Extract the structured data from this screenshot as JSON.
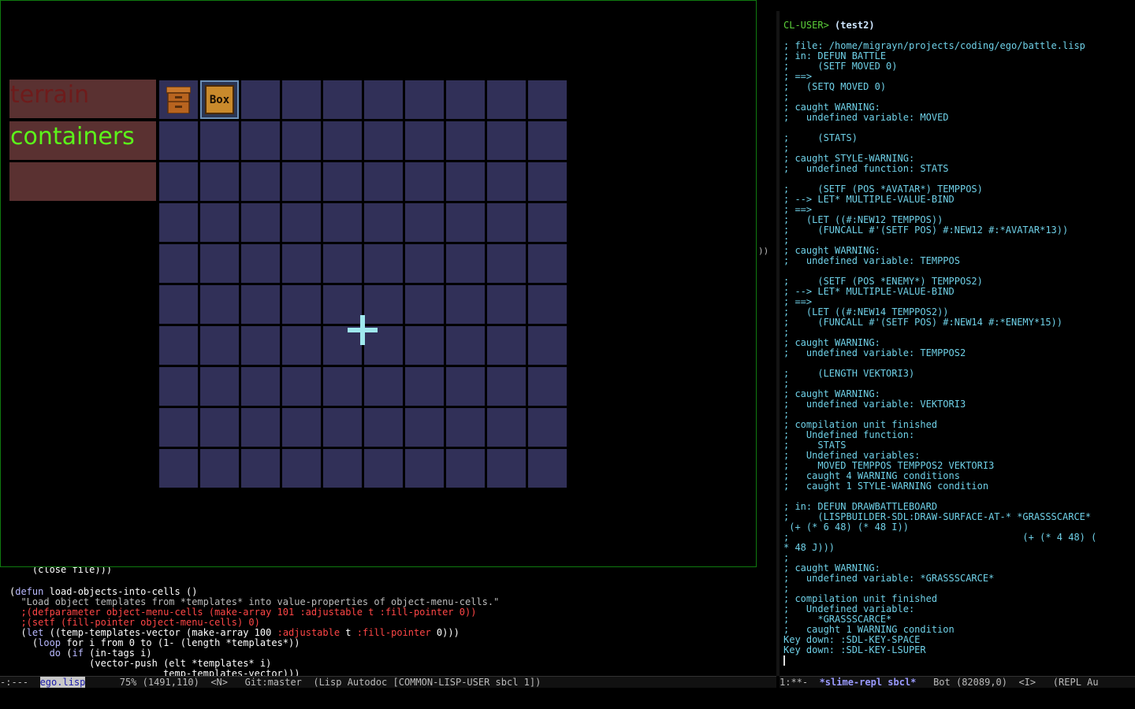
{
  "game": {
    "menu": [
      {
        "label": "terrain",
        "color": "#6e1b1b"
      },
      {
        "label": "containers",
        "color": "#5cf51a"
      },
      {
        "label": "",
        "color": "#5a3131"
      }
    ],
    "grid": {
      "cols": 10,
      "rows": 10,
      "cell_color": "#313058",
      "selected_cell": [
        1,
        0
      ]
    },
    "icons": [
      {
        "name": "cabinet-icon"
      },
      {
        "name": "box-icon",
        "text": "Box"
      }
    ]
  },
  "editor": {
    "lines": [
      {
        "segments": [
          {
            "t": "    (close file)))",
            "c": "plain"
          }
        ]
      },
      {
        "segments": [
          {
            "t": "(",
            "c": "plain"
          },
          {
            "t": "defun",
            "c": "kw"
          },
          {
            "t": " load-objects-into-cells ()",
            "c": "plain"
          }
        ]
      },
      {
        "segments": [
          {
            "t": "  \"Load object templates from *templates* into value-properties of object-menu-cells.\"",
            "c": "str"
          }
        ]
      },
      {
        "segments": [
          {
            "t": "  ;(defparameter object-menu-cells (make-array 101 :adjustable t :fill-pointer 0))",
            "c": "cmt"
          }
        ]
      },
      {
        "segments": [
          {
            "t": "  ;(setf (fill-pointer object-menu-cells) 0)",
            "c": "cmt"
          }
        ]
      },
      {
        "segments": [
          {
            "t": "  (",
            "c": "plain"
          },
          {
            "t": "let",
            "c": "kw"
          },
          {
            "t": " ((temp-templates-vector (make-array 100 ",
            "c": "plain"
          },
          {
            "t": ":adjustable",
            "c": "cmt"
          },
          {
            "t": " t ",
            "c": "plain"
          },
          {
            "t": ":fill-pointer",
            "c": "cmt"
          },
          {
            "t": " 0)))",
            "c": "plain"
          }
        ]
      },
      {
        "segments": [
          {
            "t": "    (",
            "c": "plain"
          },
          {
            "t": "loop",
            "c": "kw"
          },
          {
            "t": " for i from 0 to (1- (length *templates*))",
            "c": "plain"
          }
        ]
      },
      {
        "segments": [
          {
            "t": "       ",
            "c": "plain"
          },
          {
            "t": "do",
            "c": "kw"
          },
          {
            "t": " (",
            "c": "plain"
          },
          {
            "t": "if",
            "c": "kw"
          },
          {
            "t": " (in-tags i)",
            "c": "plain"
          }
        ]
      },
      {
        "segments": [
          {
            "t": "              (vector-push (elt *templates* i)",
            "c": "plain"
          }
        ]
      },
      {
        "segments": [
          {
            "t": "                           temp-templates-vector)))",
            "c": "plain"
          }
        ]
      }
    ],
    "modeline": {
      "prefix": "-:---  ",
      "buffer": "ego.lisp",
      "rest": "      75% (1491,110)  <N>   Git:master  (Lisp Autodoc [COMMON-LISP-USER sbcl 1])"
    }
  },
  "repl": {
    "prompt": "CL-USER>",
    "command": "(test2)",
    "output": [
      "",
      "; file: /home/migrayn/projects/coding/ego/battle.lisp",
      "; in: DEFUN BATTLE",
      ";     (SETF MOVED 0)",
      "; ==>",
      ";   (SETQ MOVED 0)",
      ";",
      "; caught WARNING:",
      ";   undefined variable: MOVED",
      "",
      ";     (STATS)",
      ";",
      "; caught STYLE-WARNING:",
      ";   undefined function: STATS",
      "",
      ";     (SETF (POS *AVATAR*) TEMPPOS)",
      "; --> LET* MULTIPLE-VALUE-BIND",
      "; ==>",
      ";   (LET ((#:NEW12 TEMPPOS))",
      ";     (FUNCALL #'(SETF POS) #:NEW12 #:*AVATAR*13))",
      ";",
      "; caught WARNING:",
      ";   undefined variable: TEMPPOS",
      "",
      ";     (SETF (POS *ENEMY*) TEMPPOS2)",
      "; --> LET* MULTIPLE-VALUE-BIND",
      "; ==>",
      ";   (LET ((#:NEW14 TEMPPOS2))",
      ";     (FUNCALL #'(SETF POS) #:NEW14 #:*ENEMY*15))",
      ";",
      "; caught WARNING:",
      ";   undefined variable: TEMPPOS2",
      "",
      ";     (LENGTH VEKTORI3)",
      ";",
      "; caught WARNING:",
      ";   undefined variable: VEKTORI3",
      ";",
      "; compilation unit finished",
      ";   Undefined function:",
      ";     STATS",
      ";   Undefined variables:",
      ";     MOVED TEMPPOS TEMPPOS2 VEKTORI3",
      ";   caught 4 WARNING conditions",
      ";   caught 1 STYLE-WARNING condition",
      "",
      "; in: DEFUN DRAWBATTLEBOARD",
      ";     (LISPBUILDER-SDL:DRAW-SURFACE-AT-* *GRASSSCARCE*",
      " (+ (* 6 48) (* 48 I))",
      ";                                         (+ (* 4 48) (",
      "* 48 J)))",
      ";",
      "; caught WARNING:",
      ";   undefined variable: *GRASSSCARCE*",
      ";",
      "; compilation unit finished",
      ";   Undefined variable:",
      ";     *GRASSSCARCE*",
      ";   caught 1 WARNING condition",
      "Key down: :SDL-KEY-SPACE",
      "Key down: :SDL-KEY-LSUPER"
    ],
    "modeline": {
      "prefix": "1:**-  ",
      "buffer": "*slime-repl sbcl*",
      "rest": "   Bot (82089,0)  <I>   (REPL Au"
    }
  },
  "fringe": "))"
}
